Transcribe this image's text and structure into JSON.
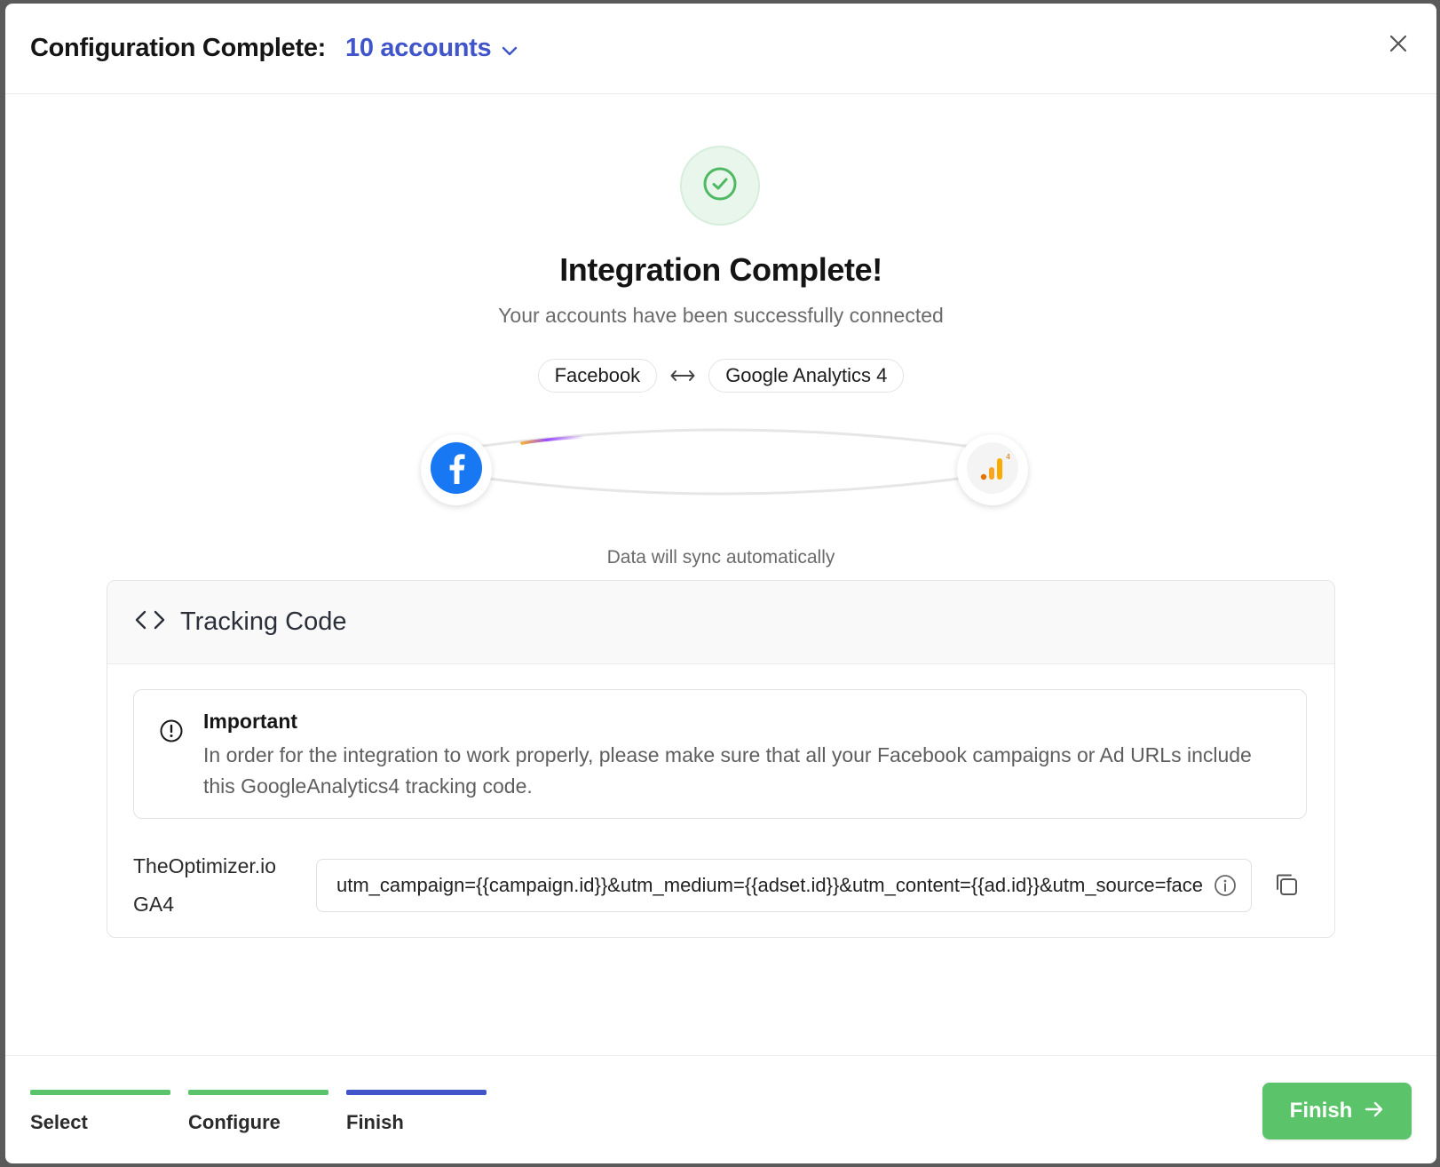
{
  "header": {
    "title": "Configuration Complete:",
    "accounts_label": "10 accounts"
  },
  "status": {
    "title": "Integration Complete!",
    "subtitle": "Your accounts have been successfully connected",
    "source_name": "Facebook",
    "destination_name": "Google Analytics 4",
    "sync_note": "Data will sync automatically"
  },
  "tracking": {
    "title": "Tracking Code",
    "alert_title": "Important",
    "alert_text": "In order for the integration to work properly, please make sure that all your Facebook campaigns or Ad URLs include this GoogleAnalytics4 tracking code.",
    "tool_name": "TheOptimizer.io",
    "tool_sub": "GA4",
    "code": "utm_campaign={{campaign.id}}&utm_medium={{adset.id}}&utm_content={{ad.id}}&utm_source=facebook"
  },
  "steps": [
    {
      "label": "Select",
      "color": "#5bc46a"
    },
    {
      "label": "Configure",
      "color": "#5bc46a"
    },
    {
      "label": "Finish",
      "color": "#3f55c9"
    }
  ],
  "footer": {
    "finish_label": "Finish"
  },
  "colors": {
    "accent": "#3f55c9",
    "success": "#5bc46a",
    "facebook": "#1877f2",
    "ga_orange": "#f9ab00"
  }
}
